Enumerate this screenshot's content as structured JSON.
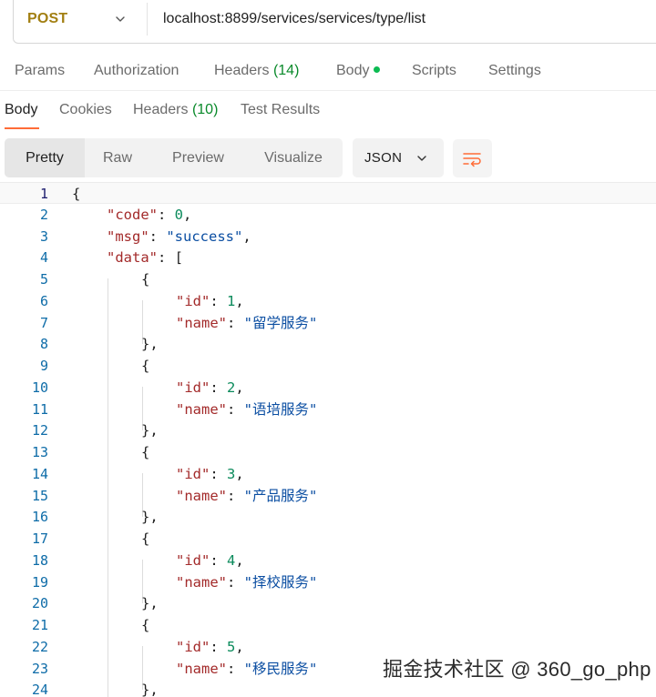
{
  "request": {
    "method": "POST",
    "url": "localhost:8899/services/services/type/list"
  },
  "request_tabs": {
    "params": "Params",
    "authorization": "Authorization",
    "headers_label": "Headers",
    "headers_count": "(14)",
    "body": "Body",
    "scripts": "Scripts",
    "settings": "Settings"
  },
  "response_tabs": {
    "body": "Body",
    "cookies": "Cookies",
    "headers_label": "Headers",
    "headers_count": "(10)",
    "test_results": "Test Results"
  },
  "toolbar": {
    "pretty": "Pretty",
    "raw": "Raw",
    "preview": "Preview",
    "visualize": "Visualize",
    "format": "JSON"
  },
  "code": {
    "lines": [
      {
        "no": "1",
        "parts": [
          [
            "p",
            "{"
          ]
        ]
      },
      {
        "no": "2",
        "parts": [
          [
            "k",
            "\"code\""
          ],
          [
            "p",
            ": "
          ],
          [
            "n",
            "0"
          ],
          [
            "p",
            ","
          ]
        ]
      },
      {
        "no": "3",
        "parts": [
          [
            "k",
            "\"msg\""
          ],
          [
            "p",
            ": "
          ],
          [
            "s",
            "\"success\""
          ],
          [
            "p",
            ","
          ]
        ]
      },
      {
        "no": "4",
        "parts": [
          [
            "k",
            "\"data\""
          ],
          [
            "p",
            ": ["
          ]
        ]
      },
      {
        "no": "5",
        "parts": [
          [
            "p",
            "{"
          ]
        ]
      },
      {
        "no": "6",
        "parts": [
          [
            "k",
            "\"id\""
          ],
          [
            "p",
            ": "
          ],
          [
            "n",
            "1"
          ],
          [
            "p",
            ","
          ]
        ]
      },
      {
        "no": "7",
        "parts": [
          [
            "k",
            "\"name\""
          ],
          [
            "p",
            ": "
          ],
          [
            "s",
            "\"留学服务\""
          ]
        ]
      },
      {
        "no": "8",
        "parts": [
          [
            "p",
            "},"
          ]
        ]
      },
      {
        "no": "9",
        "parts": [
          [
            "p",
            "{"
          ]
        ]
      },
      {
        "no": "10",
        "parts": [
          [
            "k",
            "\"id\""
          ],
          [
            "p",
            ": "
          ],
          [
            "n",
            "2"
          ],
          [
            "p",
            ","
          ]
        ]
      },
      {
        "no": "11",
        "parts": [
          [
            "k",
            "\"name\""
          ],
          [
            "p",
            ": "
          ],
          [
            "s",
            "\"语培服务\""
          ]
        ]
      },
      {
        "no": "12",
        "parts": [
          [
            "p",
            "},"
          ]
        ]
      },
      {
        "no": "13",
        "parts": [
          [
            "p",
            "{"
          ]
        ]
      },
      {
        "no": "14",
        "parts": [
          [
            "k",
            "\"id\""
          ],
          [
            "p",
            ": "
          ],
          [
            "n",
            "3"
          ],
          [
            "p",
            ","
          ]
        ]
      },
      {
        "no": "15",
        "parts": [
          [
            "k",
            "\"name\""
          ],
          [
            "p",
            ": "
          ],
          [
            "s",
            "\"产品服务\""
          ]
        ]
      },
      {
        "no": "16",
        "parts": [
          [
            "p",
            "},"
          ]
        ]
      },
      {
        "no": "17",
        "parts": [
          [
            "p",
            "{"
          ]
        ]
      },
      {
        "no": "18",
        "parts": [
          [
            "k",
            "\"id\""
          ],
          [
            "p",
            ": "
          ],
          [
            "n",
            "4"
          ],
          [
            "p",
            ","
          ]
        ]
      },
      {
        "no": "19",
        "parts": [
          [
            "k",
            "\"name\""
          ],
          [
            "p",
            ": "
          ],
          [
            "s",
            "\"择校服务\""
          ]
        ]
      },
      {
        "no": "20",
        "parts": [
          [
            "p",
            "},"
          ]
        ]
      },
      {
        "no": "21",
        "parts": [
          [
            "p",
            "{"
          ]
        ]
      },
      {
        "no": "22",
        "parts": [
          [
            "k",
            "\"id\""
          ],
          [
            "p",
            ": "
          ],
          [
            "n",
            "5"
          ],
          [
            "p",
            ","
          ]
        ]
      },
      {
        "no": "23",
        "parts": [
          [
            "k",
            "\"name\""
          ],
          [
            "p",
            ": "
          ],
          [
            "s",
            "\"移民服务\""
          ]
        ]
      },
      {
        "no": "24",
        "parts": [
          [
            "p",
            "},"
          ]
        ]
      }
    ]
  },
  "watermark": "掘金技术社区 @ 360_go_php",
  "colors": {
    "method": "#a27f12",
    "count": "#0a8a2b",
    "active_tab_underline": "#ff6c37",
    "body_dot": "#0cbb52",
    "json_key": "#a32a2a",
    "json_string": "#0b4ea2",
    "json_number": "#0a8a5b",
    "line_number": "#0e6ca8"
  },
  "icons": {
    "method_dropdown": "chevron-down-icon",
    "format_dropdown": "chevron-down-icon",
    "wrap": "wrap-lines-icon"
  }
}
